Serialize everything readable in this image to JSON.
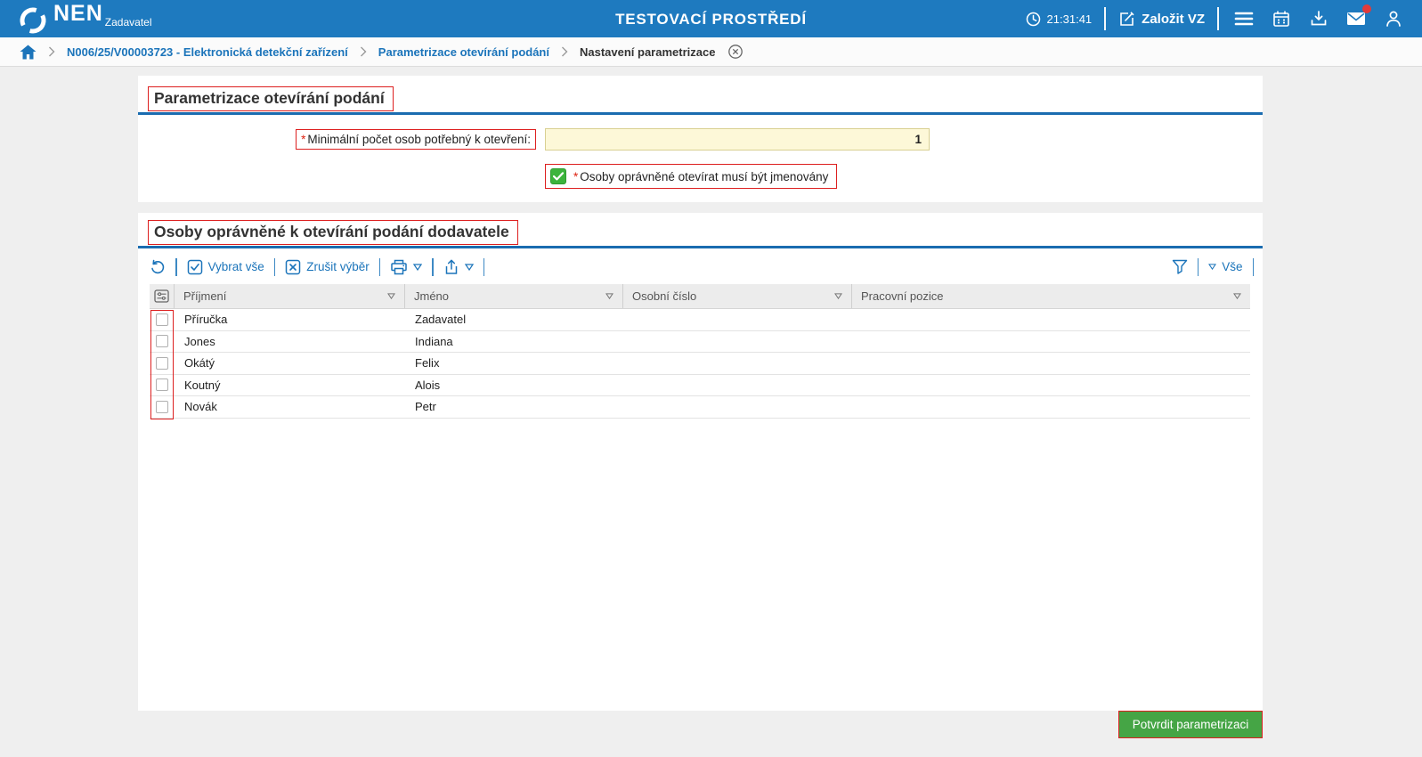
{
  "header": {
    "logo": "NEN",
    "logo_role": "Zadavatel",
    "environment": "TESTOVACÍ PROSTŘEDÍ",
    "time": "21:31:41",
    "create_vz_label": "Založit VZ"
  },
  "breadcrumb": {
    "items": [
      "N006/25/V00003723 - Elektronická detekční zařízení",
      "Parametrizace otevírání podání",
      "Nastavení parametrizace"
    ]
  },
  "parametrization": {
    "title": "Parametrizace otevírání podání",
    "required_mark": "*",
    "min_persons_label": "Minimální počet osob potřebný k otevření:",
    "min_persons_value": "1",
    "named_label": "Osoby oprávněné otevírat musí být jmenovány",
    "named_checked": true
  },
  "persons": {
    "title": "Osoby oprávněné k otevírání podání dodavatele",
    "toolbar": {
      "select_all": "Vybrat vše",
      "clear_selection": "Zrušit výběr",
      "filter_all": "Vše"
    },
    "table": {
      "columns": [
        "Příjmení",
        "Jméno",
        "Osobní číslo",
        "Pracovní pozice"
      ],
      "rows": [
        [
          "Příručka",
          "Zadavatel",
          "",
          ""
        ],
        [
          "Jones",
          "Indiana",
          "",
          ""
        ],
        [
          "Okátý",
          "Felix",
          "",
          ""
        ],
        [
          "Koutný",
          "Alois",
          "",
          ""
        ],
        [
          "Novák",
          "Petr",
          "",
          ""
        ]
      ]
    }
  },
  "footer": {
    "confirm_label": "Potvrdit parametrizaci"
  },
  "colors": {
    "header_blue": "#1e7abf",
    "link_blue": "#1b74ba",
    "section_line_blue": "#1a6cb0",
    "annotation_red": "#dd1f1f",
    "input_yellow": "#fdf8d8",
    "checkbox_green": "#3cb43c",
    "button_green": "#45a545",
    "badge_red": "#e23a3a"
  }
}
